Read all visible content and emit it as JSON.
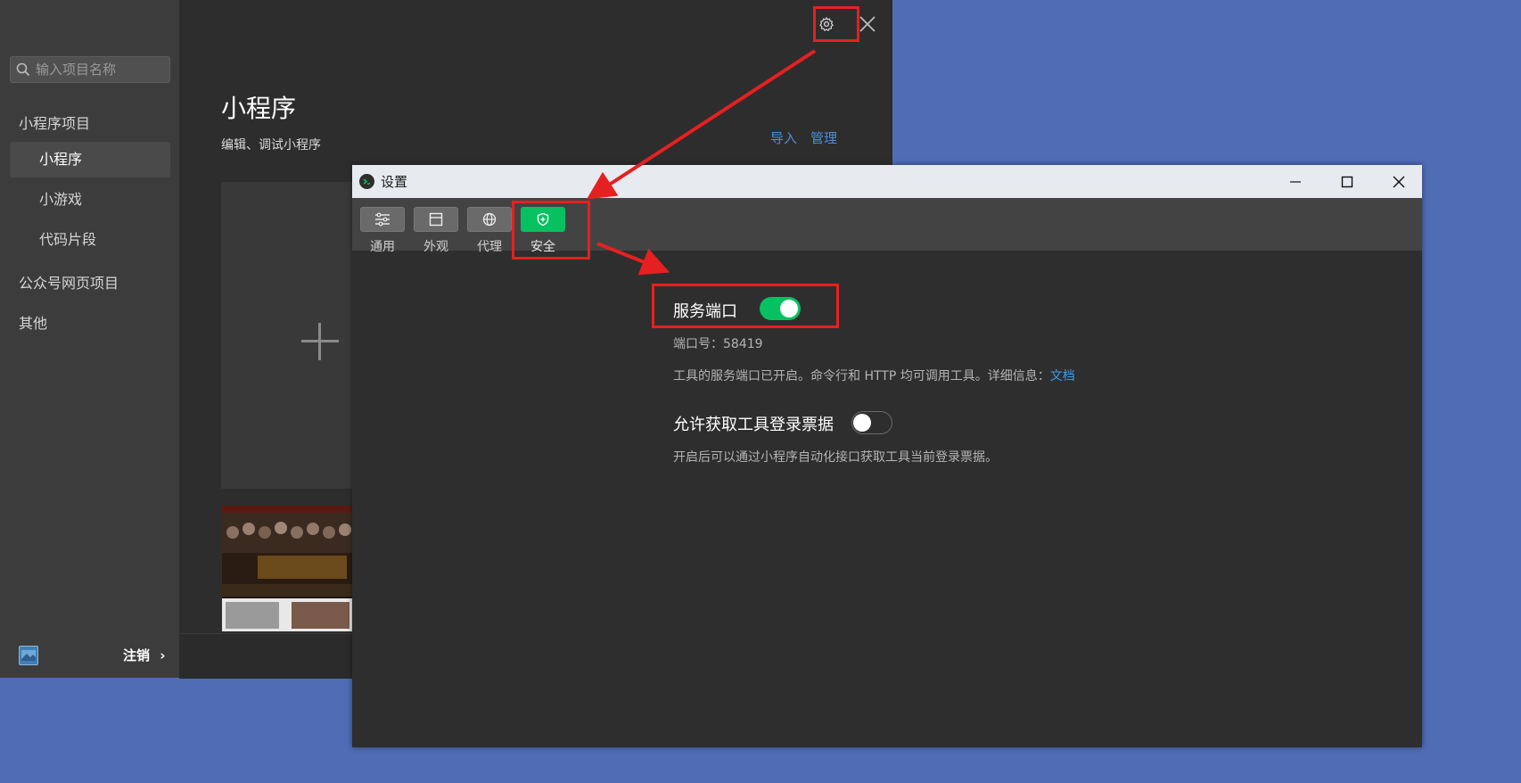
{
  "main_window": {
    "search": {
      "placeholder": "输入项目名称",
      "value": ""
    },
    "sidebar": {
      "groups": [
        {
          "label": "小程序项目",
          "items": [
            {
              "label": "小程序",
              "active": true
            },
            {
              "label": "小游戏",
              "active": false
            },
            {
              "label": "代码片段",
              "active": false
            }
          ]
        },
        {
          "label": "公众号网页项目"
        },
        {
          "label": "其他"
        }
      ],
      "footer": {
        "logout_label": "注销",
        "logout_chevron": "›"
      }
    },
    "header": {
      "title": "小程序",
      "subtitle": "编辑、调试小程序"
    },
    "actions": {
      "import_label": "导入",
      "manage_label": "管理"
    },
    "icons": {
      "settings": "gear-icon",
      "close": "close-icon",
      "search": "search-icon",
      "new_project": "plus-icon"
    }
  },
  "settings_dialog": {
    "title": "设置",
    "window_controls": [
      "minimize",
      "maximize",
      "close"
    ],
    "tabs": [
      {
        "label": "通用",
        "icon": "sliders-icon",
        "active": false
      },
      {
        "label": "外观",
        "icon": "layout-icon",
        "active": false
      },
      {
        "label": "代理",
        "icon": "globe-icon",
        "active": false
      },
      {
        "label": "安全",
        "icon": "shield-icon",
        "active": true
      }
    ],
    "security": {
      "service_port": {
        "label": "服务端口",
        "enabled": true,
        "port_text": "端口号：58419",
        "description": "工具的服务端口已开启。命令行和 HTTP 均可调用工具。详细信息：",
        "docs_link": "文档"
      },
      "login_ticket": {
        "label": "允许获取工具登录票据",
        "enabled": false,
        "description": "开启后可以通过小程序自动化接口获取工具当前登录票据。"
      }
    }
  },
  "colors": {
    "desktop": "#4f6cb5",
    "accent_green": "#07c160",
    "annotation_red": "#e62020",
    "link_blue": "#3b9cf0"
  }
}
